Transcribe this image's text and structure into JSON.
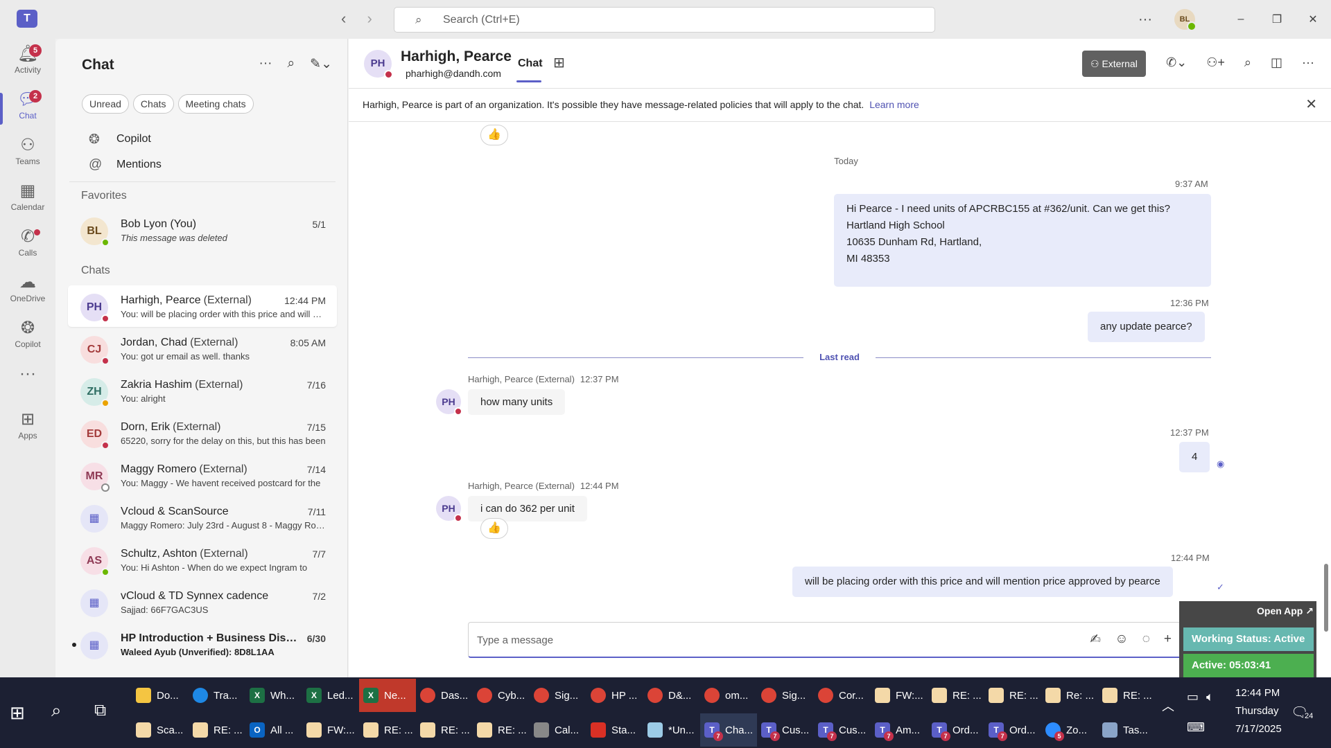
{
  "app": {
    "logo_text": "T"
  },
  "search": {
    "placeholder": "Search (Ctrl+E)"
  },
  "user_avatar": "BL",
  "rail": [
    {
      "label": "Activity",
      "badge": "5"
    },
    {
      "label": "Chat",
      "badge": "2"
    },
    {
      "label": "Teams"
    },
    {
      "label": "Calendar"
    },
    {
      "label": "Calls"
    },
    {
      "label": "OneDrive"
    },
    {
      "label": "Copilot"
    },
    {
      "label": "Apps"
    }
  ],
  "list": {
    "title": "Chat",
    "filters": [
      "Unread",
      "Chats",
      "Meeting chats"
    ],
    "nav": [
      "Copilot",
      "Mentions"
    ],
    "favorites_label": "Favorites",
    "chats_label": "Chats",
    "favorite": {
      "initials": "BL",
      "name": "Bob Lyon (You)",
      "preview": "This message was deleted",
      "time": "5/1"
    },
    "chats": [
      {
        "initials": "PH",
        "name": "Harhigh, Pearce",
        "ext": "(External)",
        "preview": "You: will be placing order with this price and will mention price approved by pearce",
        "time": "12:44 PM"
      },
      {
        "initials": "CJ",
        "name": "Jordan, Chad",
        "ext": "(External)",
        "preview": "You: got ur email as well. thanks",
        "time": "8:05 AM"
      },
      {
        "initials": "ZH",
        "name": "Zakria Hashim",
        "ext": "(External)",
        "preview": "You: alright",
        "time": "7/16"
      },
      {
        "initials": "ED",
        "name": "Dorn, Erik",
        "ext": "(External)",
        "preview": "65220, sorry for the delay on this, but this has been",
        "time": "7/15"
      },
      {
        "initials": "MR",
        "name": "Maggy Romero",
        "ext": "(External)",
        "preview": "You: Maggy - We havent received postcard for the",
        "time": "7/14"
      },
      {
        "initials": "",
        "name": "Vcloud & ScanSource",
        "ext": "",
        "preview": "Maggy Romero: July 23rd - August 8 - Maggy Romero",
        "time": "7/11"
      },
      {
        "initials": "AS",
        "name": "Schultz, Ashton",
        "ext": "(External)",
        "preview": "You: Hi Ashton -  When do we expect Ingram to",
        "time": "7/7"
      },
      {
        "initials": "",
        "name": "vCloud & TD Synnex cadence",
        "ext": "",
        "preview": "Sajjad: 66F7GAC3US",
        "time": "7/2"
      },
      {
        "initials": "",
        "name": "HP Introduction + Business Discussion",
        "ext": "",
        "preview": "Waleed Ayub (Unverified): 8D8L1AA",
        "time": "6/30"
      }
    ]
  },
  "header": {
    "initials": "PH",
    "name": "Harhigh, Pearce",
    "email": "pharhigh@dandh.com",
    "tab": "Chat",
    "external_label": "External"
  },
  "banner": {
    "text": "Harhigh, Pearce is part of an organization. It's possible they have message-related policies that will apply to the chat.",
    "link": "Learn more"
  },
  "messages": {
    "date_sep": "Today",
    "m1_time": "9:37 AM",
    "m1_lines": [
      "Hi Pearce -  I need units of APCRBC155 at #362/unit. Can we get this?",
      "Hartland High School",
      "10635 Dunham Rd, Hartland,",
      "MI 48353"
    ],
    "m2_time": "12:36 PM",
    "m2_text": "any update pearce?",
    "last_read": "Last read",
    "m3_sender": "Harhigh, Pearce (External)",
    "m3_time": "12:37 PM",
    "m3_text": "how many units",
    "m4_time": "12:37 PM",
    "m4_text": "4",
    "m5_sender": "Harhigh, Pearce (External)",
    "m5_time": "12:44 PM",
    "m5_text": "i can do 362 per unit",
    "m6_time": "12:44 PM",
    "m6_text": "will be placing order with this price and will mention price approved by pearce"
  },
  "composer": {
    "placeholder": "Type a message"
  },
  "work_status": {
    "open_app": "Open App ↗",
    "status": "Working Status: Active",
    "active": "Active: 05:03:41"
  },
  "taskbar": {
    "row1": [
      "Do...",
      "Tra...",
      "Wh...",
      "Led...",
      "Ne...",
      "Das...",
      "Cyb...",
      "Sig...",
      "HP ...",
      "D&...",
      "om...",
      "Sig...",
      "Cor...",
      "FW:...",
      "RE: ...",
      "RE: ...",
      "Re: ...",
      "RE: ..."
    ],
    "row2": [
      "Sca...",
      "RE: ...",
      "All ...",
      "FW:...",
      "RE: ...",
      "RE: ...",
      "RE: ...",
      "Cal...",
      "Sta...",
      "*Un...",
      "Cha...",
      "Cus...",
      "Cus...",
      "Am...",
      "Ord...",
      "Ord...",
      "Zo...",
      "Tas..."
    ],
    "time": "12:44 PM",
    "day": "Thursday",
    "date": "7/17/2025",
    "notifications": "24"
  },
  "colors": {
    "accent": "#5b5fc7",
    "busy": "#c4314b",
    "available": "#6bb700",
    "bubble_me": "#e8ebfa"
  }
}
